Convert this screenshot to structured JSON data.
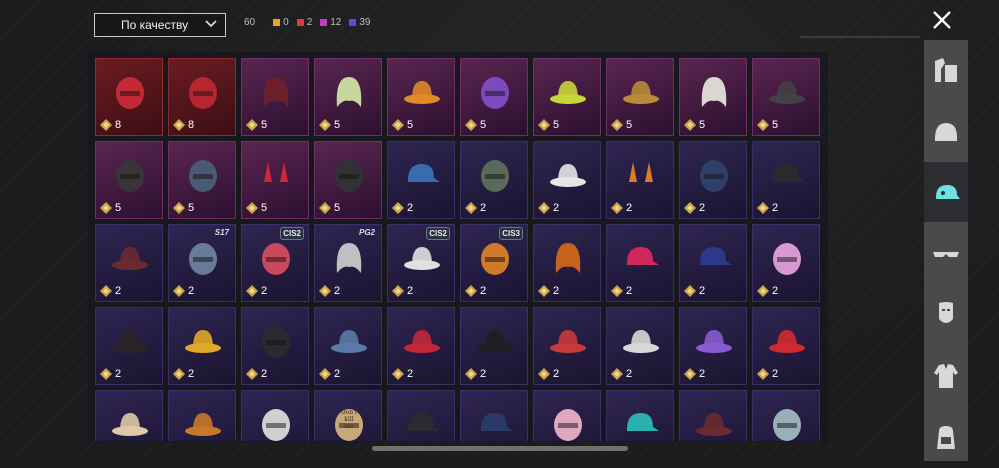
{
  "sort": {
    "label": "По качеству"
  },
  "stats": {
    "total": "60",
    "counts": [
      {
        "value": "0",
        "color": "#e8a32a"
      },
      {
        "value": "2",
        "color": "#e23b3b"
      },
      {
        "value": "12",
        "color": "#c23bc0"
      },
      {
        "value": "39",
        "color": "#6b44d6"
      }
    ]
  },
  "items": [
    {
      "n": "8",
      "r": "r8",
      "icon": "red-mech-helmet-icon",
      "col": "#c22b35"
    },
    {
      "n": "8",
      "r": "r8",
      "icon": "red-knight-helmet-icon",
      "col": "#b7262e"
    },
    {
      "n": "5",
      "r": "r5",
      "icon": "dark-red-hair-icon",
      "col": "#6a1f2a"
    },
    {
      "n": "5",
      "r": "r5",
      "icon": "green-hair-icon",
      "col": "#c8d6a0"
    },
    {
      "n": "5",
      "r": "r5",
      "icon": "orange-blob-hat-icon",
      "col": "#e08a2a"
    },
    {
      "n": "5",
      "r": "r5",
      "icon": "purple-robot-helmet-icon",
      "col": "#7b4bbd"
    },
    {
      "n": "5",
      "r": "r5",
      "icon": "yellow-bucket-hat-icon",
      "col": "#c8d63a"
    },
    {
      "n": "5",
      "r": "r5",
      "icon": "golden-crown-icon",
      "col": "#b88a3a"
    },
    {
      "n": "5",
      "r": "r5",
      "icon": "white-dreadlocks-icon",
      "col": "#d8d8d0"
    },
    {
      "n": "5",
      "r": "r5",
      "icon": "black-bow-hat-icon",
      "col": "#444046"
    },
    {
      "n": "5",
      "r": "r5",
      "icon": "dark-hood-icon",
      "col": "#3a343a"
    },
    {
      "n": "5",
      "r": "r5",
      "icon": "blue-tactical-helmet-icon",
      "col": "#4a5a74"
    },
    {
      "n": "5",
      "r": "r5",
      "icon": "red-horns-icon",
      "col": "#d0283a"
    },
    {
      "n": "5",
      "r": "r5",
      "icon": "black-mask-icon",
      "col": "#303236"
    },
    {
      "n": "2",
      "r": "r2",
      "icon": "blue-cap-icon",
      "col": "#3a6ab0"
    },
    {
      "n": "2",
      "r": "r2",
      "icon": "green-helmet-icon",
      "col": "#5a6a5a"
    },
    {
      "n": "2",
      "r": "r2",
      "icon": "white-sun-hat-icon",
      "col": "#e6e6e6"
    },
    {
      "n": "2",
      "r": "r2",
      "icon": "orange-horns-icon",
      "col": "#e07a2a"
    },
    {
      "n": "2",
      "r": "r2",
      "icon": "navy-beanie-icon",
      "col": "#2e4068"
    },
    {
      "n": "2",
      "r": "r2",
      "icon": "black-cap-icon",
      "col": "#2a2a2c"
    },
    {
      "n": "2",
      "r": "r2",
      "icon": "red-hair-bucket-hat-icon",
      "col": "#6a2a30"
    },
    {
      "n": "2",
      "r": "r2",
      "icon": "winged-helmet-icon",
      "col": "#6a7a9a",
      "badge": "S17"
    },
    {
      "n": "2",
      "r": "r2",
      "icon": "striped-beanie-icon",
      "col": "#c84a5a",
      "badge": "CIS2"
    },
    {
      "n": "2",
      "r": "r2",
      "icon": "silver-hair-icon",
      "col": "#c0c0c4",
      "badge": "PG2"
    },
    {
      "n": "2",
      "r": "r2",
      "icon": "chef-hat-mask-icon",
      "col": "#e0e0e0",
      "badge": "CIS2"
    },
    {
      "n": "2",
      "r": "r2",
      "icon": "orange-gasmask-icon",
      "col": "#d07a2a",
      "badge": "CIS3"
    },
    {
      "n": "2",
      "r": "r2",
      "icon": "orange-braids-icon",
      "col": "#c8621e"
    },
    {
      "n": "2",
      "r": "r2",
      "icon": "pink-cap-icon",
      "col": "#d0285a"
    },
    {
      "n": "2",
      "r": "r2",
      "icon": "blue-yellow-cap-icon",
      "col": "#2a3a8a"
    },
    {
      "n": "2",
      "r": "r2",
      "icon": "cat-ear-headphones-icon",
      "col": "#d69ad0"
    },
    {
      "n": "2",
      "r": "r2",
      "icon": "pirate-hat-icon",
      "col": "#2a2426"
    },
    {
      "n": "2",
      "r": "r2",
      "icon": "yellow-rain-hat-icon",
      "col": "#e0a82a"
    },
    {
      "n": "2",
      "r": "r2",
      "icon": "wrestler-mask-icon",
      "col": "#2a2a30"
    },
    {
      "n": "2",
      "r": "r2",
      "icon": "shark-hat-icon",
      "col": "#5a7aa8"
    },
    {
      "n": "2",
      "r": "r2",
      "icon": "red-beret-icon",
      "col": "#c0283a"
    },
    {
      "n": "2",
      "r": "r2",
      "icon": "black-fedora-icon",
      "col": "#1e1e22"
    },
    {
      "n": "2",
      "r": "r2",
      "icon": "red-fedora-icon",
      "col": "#c83a3a"
    },
    {
      "n": "2",
      "r": "r2",
      "icon": "white-shark-hat-icon",
      "col": "#d8d8d8"
    },
    {
      "n": "2",
      "r": "r2",
      "icon": "flower-crown-icon",
      "col": "#8a5ad0"
    },
    {
      "n": "2",
      "r": "r2",
      "icon": "red-bucket-hat-icon",
      "col": "#d02a30"
    },
    {
      "n": "",
      "r": "r2",
      "icon": "cupcake-hat-icon",
      "col": "#e0c8a8"
    },
    {
      "n": "",
      "r": "r2",
      "icon": "burger-hat-icon",
      "col": "#c8782a"
    },
    {
      "n": "",
      "r": "r2",
      "icon": "headband-icon",
      "col": "#d0d0d0"
    },
    {
      "n": "",
      "r": "r2",
      "icon": "paper-bag-icon",
      "col": "#c8a878",
      "bag": "Don't kill me"
    },
    {
      "n": "",
      "r": "r2",
      "icon": "black-visor-icon",
      "col": "#2a2a30"
    },
    {
      "n": "",
      "r": "r2",
      "icon": "navy-sailor-cap-icon",
      "col": "#2a3a68"
    },
    {
      "n": "",
      "r": "r2",
      "icon": "pink-beanie-icon",
      "col": "#e0a8c0"
    },
    {
      "n": "",
      "r": "r2",
      "icon": "teal-cap-icon",
      "col": "#2ab0b0"
    },
    {
      "n": "",
      "r": "r2",
      "icon": "maroon-fedora-icon",
      "col": "#6a2a30"
    },
    {
      "n": "",
      "r": "r2",
      "icon": "checkered-helmet-icon",
      "col": "#9ab0b8"
    }
  ],
  "sidebar": [
    {
      "icon": "outfit-icon",
      "active": false
    },
    {
      "icon": "helmet-icon",
      "active": false
    },
    {
      "icon": "cap-icon",
      "active": true
    },
    {
      "icon": "glasses-icon",
      "active": false
    },
    {
      "icon": "face-mask-icon",
      "active": false
    },
    {
      "icon": "jacket-icon",
      "active": false
    },
    {
      "icon": "backpack-icon",
      "active": false
    }
  ]
}
